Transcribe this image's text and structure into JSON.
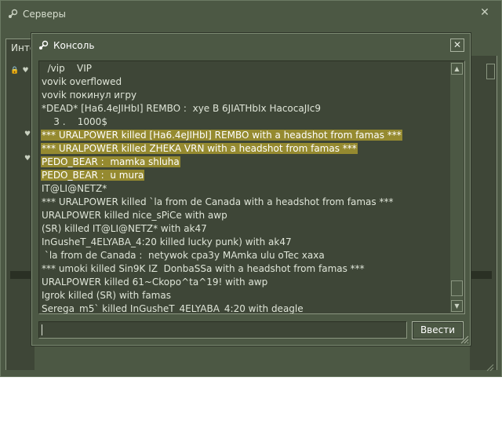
{
  "background_window": {
    "title": "Серверы",
    "tab_label": "Инте",
    "close_glyph": "✕"
  },
  "console": {
    "title": "Консоль",
    "close_glyph": "✕",
    "lines": [
      {
        "text": "  /vip    VIP",
        "highlight": false
      },
      {
        "text": "vovik overflowed",
        "highlight": false
      },
      {
        "text": "vovik покинул игру",
        "highlight": false
      },
      {
        "text": "*DEAD* [Ha6.4eJIHbI] REMBO :  xye B 6JIATHbIx HacocaJIc9",
        "highlight": false
      },
      {
        "text": "    3 .    1000$",
        "highlight": false
      },
      {
        "text": "*** URALPOWER killed [Ha6.4eJIHbI] REMBO with a headshot from famas ***",
        "highlight": true
      },
      {
        "text": "*** URALPOWER killed ZHEKA VRN with a headshot from famas ***",
        "highlight": true
      },
      {
        "text": "PEDO_BEAR :  mamka shluha",
        "highlight": true
      },
      {
        "text": "PEDO_BEAR :  u mura",
        "highlight": true
      },
      {
        "text": "IT@LI@NETZ*",
        "highlight": false
      },
      {
        "text": "*** URALPOWER killed `la from de Canada with a headshot from famas ***",
        "highlight": false
      },
      {
        "text": "URALPOWER killed nice_sPiCe with awp",
        "highlight": false
      },
      {
        "text": "(SR) killed IT@LI@NETZ* with ak47",
        "highlight": false
      },
      {
        "text": "InGusheT_4ELYABA_4:20 killed lucky punk) with ak47",
        "highlight": false
      },
      {
        "text": " `la from de Canada :  netywok cpa3y MAmka ulu oTec xaxa",
        "highlight": false
      },
      {
        "text": "*** umoki killed Sin9K IZ  DonbaSSa with a headshot from famas ***",
        "highlight": false
      },
      {
        "text": "URALPOWER killed 61~Ckopo^ta^19! with awp",
        "highlight": false
      },
      {
        "text": "Igrok killed (SR) with famas",
        "highlight": false
      },
      {
        "text": "Serega_m5` killed InGusheT_4ELYABA_4:20 with deagle",
        "highlight": false
      }
    ],
    "input_value": "",
    "submit_label": "Ввести",
    "scroll_up_glyph": "▲",
    "scroll_down_glyph": "▼"
  },
  "icons": [
    "steam-icon",
    "close-icon",
    "lock-icon",
    "heart-icon",
    "scroll-up-icon",
    "scroll-down-icon",
    "resize-grip-icon"
  ],
  "colors": {
    "window_bg": "#4c5844",
    "panel_bg": "#3e4637",
    "highlight_bg": "#958a30",
    "text": "#dfe5d8"
  }
}
